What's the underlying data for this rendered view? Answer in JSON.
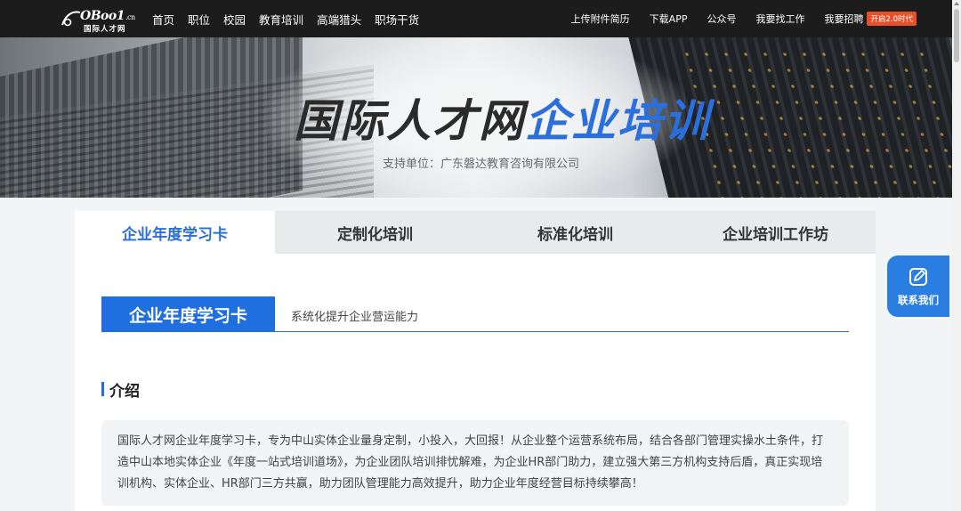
{
  "logo": {
    "brand": "OBoo1",
    "brand_suffix": ".cn",
    "subtitle": "国际人才网"
  },
  "nav_main": [
    "首页",
    "职位",
    "校园",
    "教育培训",
    "高端猎头",
    "职场干货"
  ],
  "nav_right": [
    "上传附件简历",
    "下载APP",
    "公众号",
    "我要找工作",
    "我要招聘"
  ],
  "nav_badge": "开启2.0时代",
  "hero": {
    "title_part1": "国际人才网",
    "title_part2": "企业培训",
    "subtitle": "支持单位：广东磐达教育咨询有限公司"
  },
  "tabs": [
    "企业年度学习卡",
    "定制化培训",
    "标准化培训",
    "企业培训工作坊"
  ],
  "active_tab_index": 0,
  "section": {
    "label": "企业年度学习卡",
    "description": "系统化提升企业营运能力"
  },
  "intro": {
    "heading": "介绍",
    "body": "国际人才网企业年度学习卡，专为中山实体企业量身定制，小投入，大回报！从企业整个运营系统布局，结合各部门管理实操水土条件，打造中山本地实体企业《年度一站式培训道场》，为企业团队培训排忧解难，为企业HR部门助力，建立强大第三方机构支持后盾，真正实现培训机构、实体企业、HR部门三方共赢，助力团队管理能力高效提升，助力企业年度经营目标持续攀高！"
  },
  "contact": {
    "label": "联系我们",
    "icon": "edit-icon"
  },
  "colors": {
    "accent": "#2a6fdb",
    "nav_bg": "#1c1c1c",
    "badge": "#e8502a",
    "contact": "#2a7de1"
  }
}
